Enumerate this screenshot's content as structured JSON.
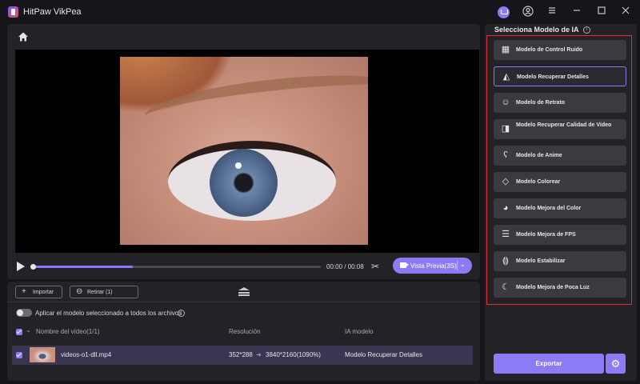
{
  "app": {
    "title": "HitPaw VikPea"
  },
  "player": {
    "time": "00:00 / 00:08",
    "preview_label": "Vista Previa(3S)",
    "progress": 0.35
  },
  "toolbar": {
    "import_label": "Importar",
    "remove_label": "Retirar (1)"
  },
  "apply_all": {
    "label": "Aplicar el modelo seleccionado a todos los archivos"
  },
  "table": {
    "headers": {
      "name": "Nombre del vídeo(1/1)",
      "resolution": "Resolución",
      "model": "IA modelo"
    },
    "rows": [
      {
        "name": "videos-o1-dll.mp4",
        "res_from": "352*288",
        "res_to": "3840*2160(1090%)",
        "model": "Modelo Recuperar Detalles"
      }
    ]
  },
  "models_panel": {
    "title": "Selecciona Modelo de IA",
    "items": [
      {
        "label": "Modelo de Control Ruido",
        "icon": "noise-icon",
        "selected": false
      },
      {
        "label": "Modelo Recuperar Detalles",
        "icon": "landscape-sparkle-icon",
        "selected": true
      },
      {
        "label": "Modelo de Retrato",
        "icon": "face-icon",
        "selected": false
      },
      {
        "label": "Modelo Recuperar Calidad de Video",
        "icon": "split-frame-icon",
        "selected": false
      },
      {
        "label": "Modelo de Anime",
        "icon": "bear-icon",
        "selected": false
      },
      {
        "label": "Modelo Colorear",
        "icon": "eraser-brush-icon",
        "selected": false
      },
      {
        "label": "Modelo Mejora del Color",
        "icon": "palette-icon",
        "selected": false
      },
      {
        "label": "Modelo Mejora de FPS",
        "icon": "frames-icon",
        "selected": false
      },
      {
        "label": "Modelo Estabilizar",
        "icon": "stabilize-icon",
        "selected": false
      },
      {
        "label": "Modelo Mejora de Poca Luz",
        "icon": "moon-icon",
        "selected": false
      }
    ]
  },
  "export": {
    "label": "Exportar"
  },
  "colors": {
    "accent": "#8b7cf6",
    "highlight_frame": "#e03030"
  }
}
